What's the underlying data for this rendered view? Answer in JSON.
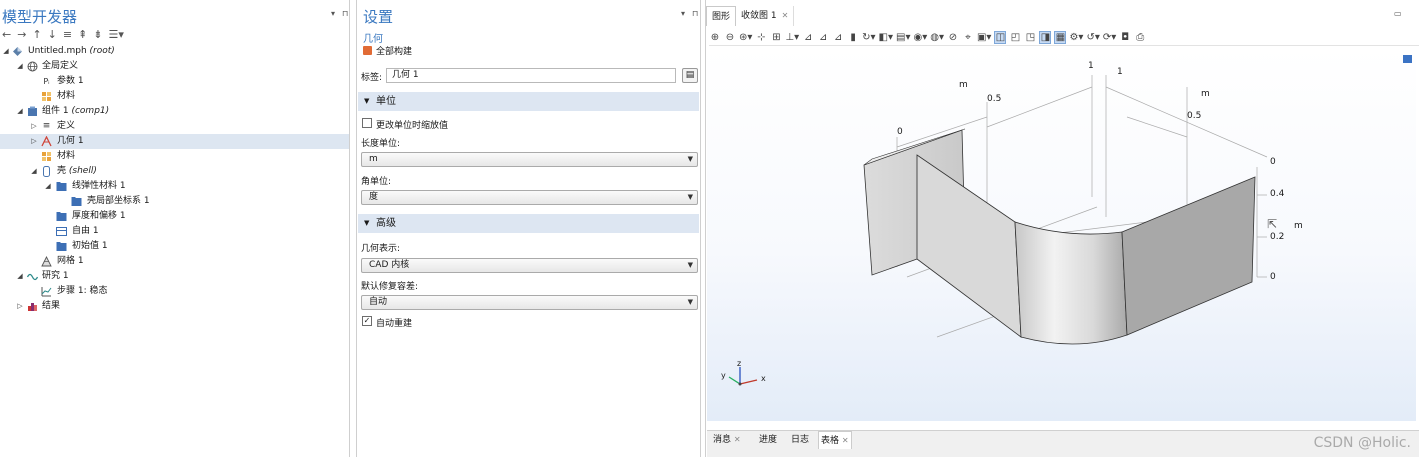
{
  "model_builder": {
    "title": "模型开发器",
    "toolbar_icons": [
      "arrow-left-icon",
      "arrow-right-icon",
      "arrow-up-icon",
      "arrow-down-icon",
      "show-icon",
      "collapse-icon",
      "expand-icon",
      "menu-icon"
    ],
    "tree": [
      {
        "label": "Untitled.mph",
        "tag": "(root)",
        "icon": "model-icon",
        "level": 0,
        "twisty": "▲"
      },
      {
        "label": "全局定义",
        "icon": "globe-icon",
        "level": 1,
        "twisty": "▲"
      },
      {
        "label": "参数 1",
        "icon": "parameters-icon",
        "level": 2
      },
      {
        "label": "材料",
        "icon": "materials-icon",
        "level": 2
      },
      {
        "label": "组件 1",
        "tag": "(comp1)",
        "icon": "component-icon",
        "level": 1,
        "twisty": "▲"
      },
      {
        "label": "定义",
        "icon": "definitions-icon",
        "level": 2,
        "twisty": "▷"
      },
      {
        "label": "几何 1",
        "icon": "geometry-icon",
        "level": 2,
        "twisty": "▷",
        "selected": true
      },
      {
        "label": "材料",
        "icon": "materials-icon",
        "level": 2
      },
      {
        "label": "壳",
        "tag": "(shell)",
        "icon": "shell-icon",
        "level": 2,
        "twisty": "▲"
      },
      {
        "label": "线弹性材料 1",
        "icon": "folder-icon",
        "level": 3,
        "twisty": "▲"
      },
      {
        "label": "壳局部坐标系 1",
        "icon": "folder-icon",
        "level": 4
      },
      {
        "label": "厚度和偏移 1",
        "icon": "folder-icon",
        "level": 3
      },
      {
        "label": "自由 1",
        "icon": "folder-icon",
        "level": 3
      },
      {
        "label": "初始值 1",
        "icon": "folder-icon",
        "level": 3
      },
      {
        "label": "网格 1",
        "icon": "mesh-icon",
        "level": 2
      },
      {
        "label": "研究 1",
        "icon": "study-icon",
        "level": 1,
        "twisty": "▲"
      },
      {
        "label": "步骤 1: 稳态",
        "icon": "step-icon",
        "level": 2
      },
      {
        "label": "结果",
        "icon": "results-icon",
        "level": 1,
        "twisty": "▷"
      }
    ]
  },
  "settings": {
    "title": "设置",
    "subtitle": "几何",
    "build_all": "全部构建",
    "label_caption": "标签:",
    "label_value": "几何 1",
    "section_units": "单位",
    "scale_on_change": "更改单位时缩放值",
    "scale_on_change_checked": false,
    "length_unit_caption": "长度单位:",
    "length_unit": "m",
    "angle_unit_caption": "角单位:",
    "angle_unit": "度",
    "section_advanced": "高级",
    "geom_rep_caption": "几何表示:",
    "geom_rep": "CAD 内核",
    "repair_tol_caption": "默认修复容差:",
    "repair_tol": "自动",
    "auto_rebuild": "自动重建",
    "auto_rebuild_checked": true,
    "check_mark": "✓"
  },
  "graphics": {
    "tabs": [
      {
        "label": "图形",
        "active": true
      },
      {
        "label": "收敛图 1",
        "closable": true,
        "active": false
      }
    ],
    "close_glyph": "✕",
    "axis_labels": {
      "x": "x",
      "y": "y",
      "z": "z"
    },
    "ruler": {
      "t1": "1",
      "t2": "1",
      "m1": "m",
      "m2": "m",
      "m3": "m",
      "h1": "0.5",
      "h2": "0.5",
      "zero1": "0",
      "zero2": "0",
      "v04": "0.4",
      "v02": "0.2",
      "zero3": "0"
    }
  },
  "bottom_tabs": [
    {
      "label": "消息",
      "closable": true
    },
    {
      "label": "进度"
    },
    {
      "label": "日志"
    },
    {
      "label": "表格",
      "closable": true,
      "active": true
    }
  ],
  "watermark": "CSDN @Holic."
}
